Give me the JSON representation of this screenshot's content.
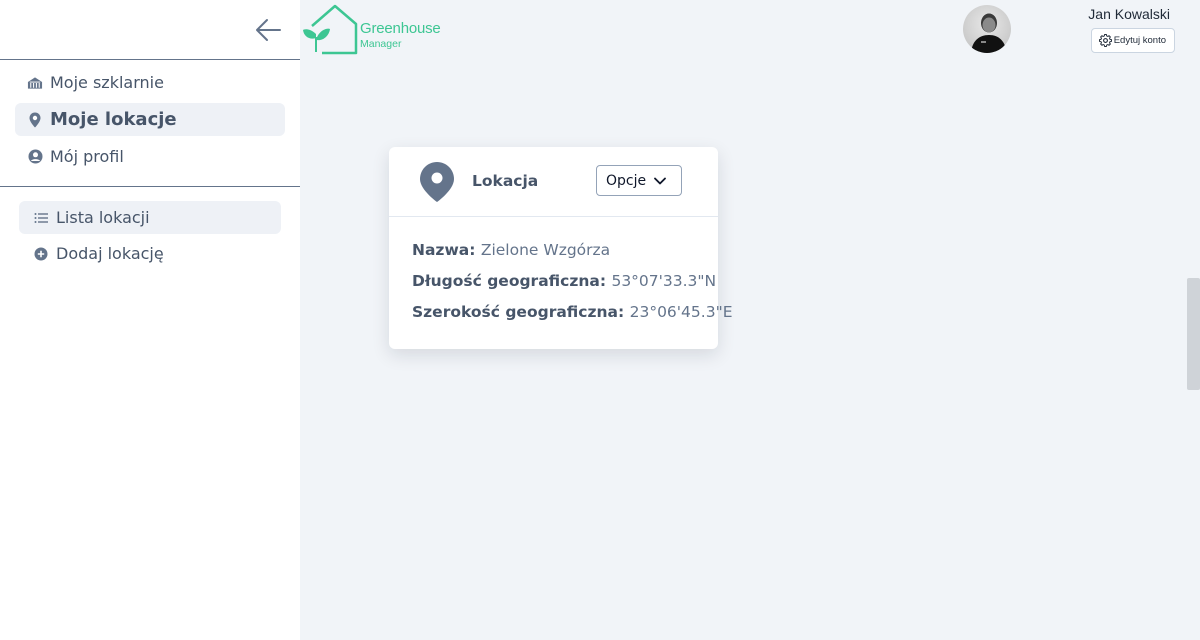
{
  "header": {
    "logo_title": "Greenhouse",
    "logo_subtitle": "Manager",
    "user_name": "Jan Kowalski",
    "edit_account_label": "Edytuj konto"
  },
  "sidebar": {
    "main_items": [
      {
        "label": "Moje szklarnie",
        "icon": "greenhouse-icon"
      },
      {
        "label": "Moje lokacje",
        "icon": "map-pin-icon",
        "active": true
      },
      {
        "label": "Mój profil",
        "icon": "user-circle-icon"
      }
    ],
    "sub_items": [
      {
        "label": "Lista lokacji",
        "icon": "list-icon",
        "active": true
      },
      {
        "label": "Dodaj lokację",
        "icon": "plus-circle-icon"
      }
    ]
  },
  "card": {
    "title": "Lokacja",
    "options_label": "Opcje",
    "fields": [
      {
        "label": "Nazwa:",
        "value": "Zielone Wzgórza"
      },
      {
        "label": "Długość geograficzna:",
        "value": "53°07'33.3\"N"
      },
      {
        "label": "Szerokość geograficzna:",
        "value": "23°06'45.3\"E"
      }
    ]
  },
  "colors": {
    "brand_green": "#3dc693",
    "text_slate": "#475569",
    "content_bg": "#f1f4f8",
    "active_bg": "#eef1f6"
  }
}
